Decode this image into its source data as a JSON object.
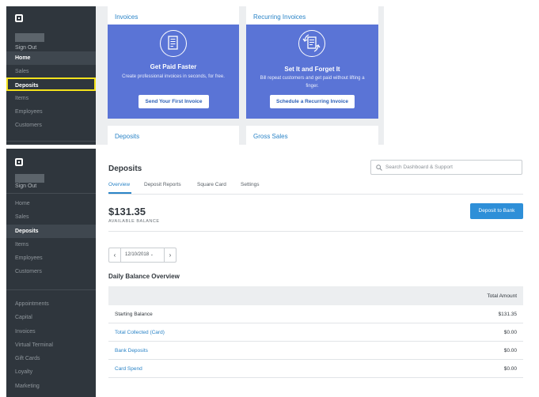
{
  "top": {
    "sidebar": {
      "sign_out": "Sign Out",
      "items": [
        "Home",
        "Sales",
        "Deposits",
        "Items",
        "Employees",
        "Customers"
      ]
    },
    "invoices_card": {
      "title": "Invoices",
      "heading": "Get Paid Faster",
      "text": "Create professional invoices in seconds, for free.",
      "button": "Send Your First Invoice"
    },
    "recurring_card": {
      "title": "Recurring Invoices",
      "heading": "Set It and Forget It",
      "text": "Bill repeat customers and get paid without lifting a finger.",
      "button": "Schedule a Recurring Invoice"
    },
    "deposits_card": {
      "title": "Deposits"
    },
    "gross_sales_card": {
      "title": "Gross Sales"
    }
  },
  "bottom": {
    "sidebar": {
      "sign_out": "Sign Out",
      "items": [
        "Home",
        "Sales",
        "Deposits",
        "Items",
        "Employees",
        "Customers"
      ],
      "apps": [
        "Appointments",
        "Capital",
        "Invoices",
        "Virtual Terminal",
        "Gift Cards",
        "Loyalty",
        "Marketing"
      ]
    },
    "page_title": "Deposits",
    "search_placeholder": "Search Dashboard & Support",
    "tabs": [
      "Overview",
      "Deposit Reports",
      "Square Card",
      "Settings"
    ],
    "balance": "$131.35",
    "balance_label": "AVAILABLE BALANCE",
    "deposit_button": "Deposit to Bank",
    "date": "12/10/2018",
    "section_title": "Daily Balance Overview",
    "table": {
      "header_amount": "Total Amount",
      "rows": [
        {
          "label": "Starting Balance",
          "amount": "$131.35"
        },
        {
          "label": "Total Collected (Card)",
          "amount": "$0.00"
        },
        {
          "label": "Bank Deposits",
          "amount": "$0.00"
        },
        {
          "label": "Card Spend",
          "amount": "$0.00"
        }
      ]
    }
  },
  "colors": {
    "sidebar_bg": "#2f363d",
    "accent_blue": "#2b84c7",
    "promo_blue": "#5a74d6",
    "highlight_yellow": "#f4e21c"
  }
}
